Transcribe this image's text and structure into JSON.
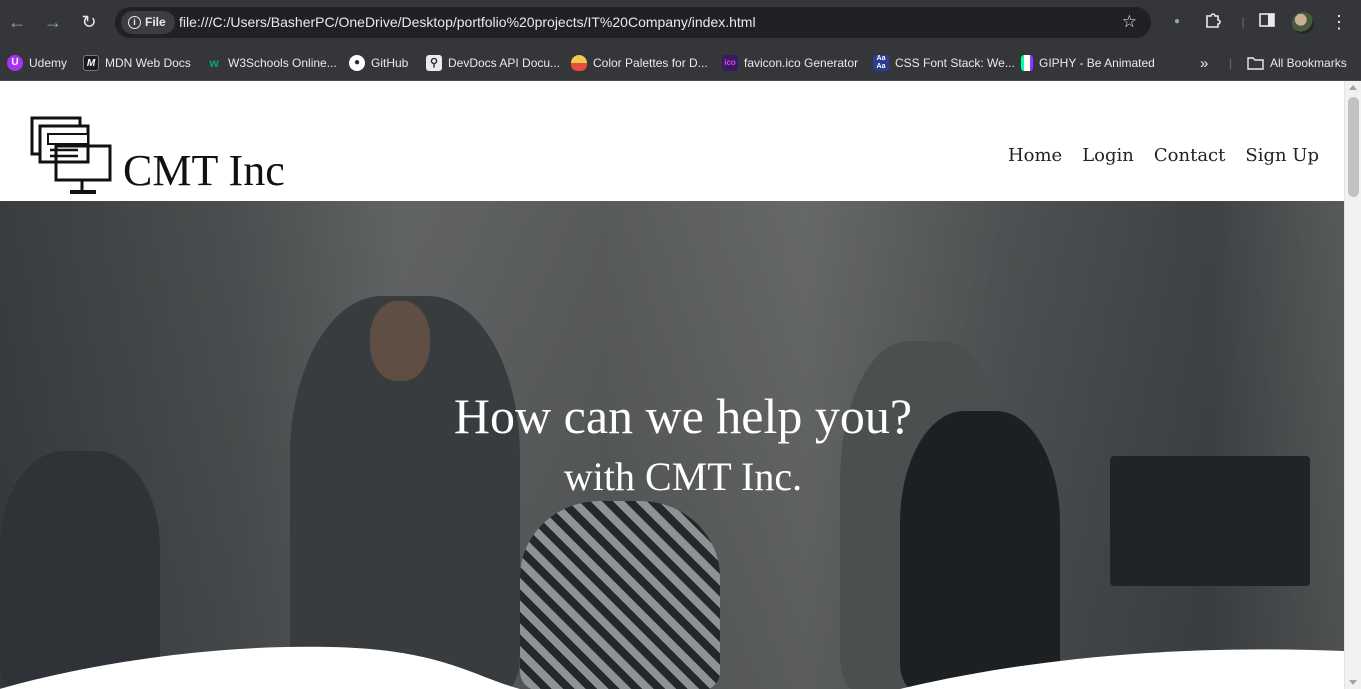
{
  "browser": {
    "site_chip": "File",
    "url": "file:///C:/Users/BasherPC/OneDrive/Desktop/portfolio%20projects/IT%20Company/index.html",
    "bookmarks": [
      {
        "label": "Udemy",
        "icon": "udemy-icon",
        "color": "#a435f0"
      },
      {
        "label": "MDN Web Docs",
        "icon": "mdn-icon",
        "color": "#1b1b1b"
      },
      {
        "label": "W3Schools Online...",
        "icon": "w3schools-icon",
        "color": "#04aa6d"
      },
      {
        "label": "GitHub",
        "icon": "github-icon",
        "color": "#ffffff"
      },
      {
        "label": "DevDocs API Docu...",
        "icon": "devdocs-icon",
        "color": "#ffffff"
      },
      {
        "label": "Color Palettes for D...",
        "icon": "color-palettes-icon",
        "color": "#f2c94c"
      },
      {
        "label": "favicon.ico Generator",
        "icon": "favicon-icon",
        "color": "#e040fb"
      },
      {
        "label": "CSS Font Stack: We...",
        "icon": "cssfontstack-icon",
        "color": "#2c3e91"
      },
      {
        "label": "GIPHY - Be Animated",
        "icon": "giphy-icon",
        "color": "#ffffff"
      }
    ],
    "all_bookmarks": "All Bookmarks",
    "overflow": "»"
  },
  "site": {
    "logo_text": "CMT Inc",
    "nav": [
      "Home",
      "Login",
      "Contact",
      "Sign Up"
    ]
  },
  "hero": {
    "title": "How can we help you?",
    "subtitle": "with CMT Inc."
  }
}
